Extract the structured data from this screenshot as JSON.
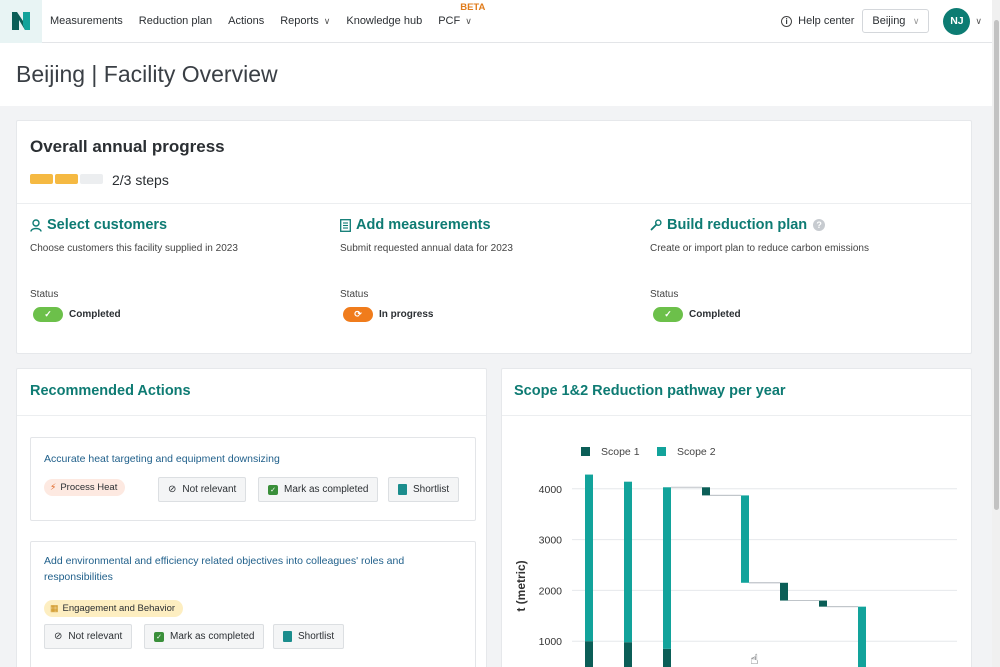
{
  "nav": {
    "items": [
      {
        "label": "Measurements",
        "chevron": false
      },
      {
        "label": "Reduction plan",
        "chevron": false
      },
      {
        "label": "Actions",
        "chevron": false
      },
      {
        "label": "Reports",
        "chevron": true
      },
      {
        "label": "Knowledge hub",
        "chevron": false
      },
      {
        "label": "PCF",
        "chevron": true
      }
    ],
    "beta_label": "BETA",
    "help_label": "Help center",
    "facility_select": "Beijing",
    "avatar_initials": "NJ"
  },
  "page_title": "Beijing | Facility Overview",
  "progress": {
    "title": "Overall annual progress",
    "steps_text": "2/3 steps",
    "completed_steps": 2,
    "total_steps": 3,
    "status_label": "Status",
    "steps": [
      {
        "title": "Select customers",
        "icon": "user-icon",
        "description": "Choose customers this facility supplied in 2023",
        "status": "Completed",
        "status_color": "#6cc04a"
      },
      {
        "title": "Add measurements",
        "icon": "document-list-icon",
        "description": "Submit requested annual data for 2023",
        "status": "In progress",
        "status_color": "#f07c1c"
      },
      {
        "title": "Build reduction plan",
        "icon": "wrench-icon",
        "description": "Create or import plan to reduce carbon emissions",
        "status": "Completed",
        "status_color": "#6cc04a"
      }
    ]
  },
  "recommended": {
    "title": "Recommended Actions",
    "actions": [
      {
        "title": "Accurate heat targeting and equipment downsizing",
        "tag": "Process Heat",
        "tag_color": "#fde9e1"
      },
      {
        "title": "Add environmental and efficiency related objectives into colleagues' roles and responsibilities",
        "tag": "Engagement and Behavior",
        "tag_color": "#fdeec1"
      }
    ],
    "btn_not_relevant": "Not relevant",
    "btn_mark_completed": "Mark as completed",
    "btn_shortlist": "Shortlist"
  },
  "chart_section_title": "Scope 1&2 Reduction pathway per year",
  "chart_data": {
    "type": "bar",
    "title": "Scope 1&2 Reduction pathway per year",
    "ylabel": "t (metric)",
    "xlabel": "",
    "ylim": [
      0,
      4300
    ],
    "yticks": [
      1000,
      2000,
      3000,
      4000
    ],
    "grid": true,
    "legend": "top",
    "series": [
      {
        "name": "Scope 1",
        "color": "#0b5e57"
      },
      {
        "name": "Scope 2",
        "color": "#12a39b"
      }
    ],
    "bars": [
      {
        "kind": "stacked",
        "scope1": 1000,
        "scope2": 3280
      },
      {
        "kind": "stacked",
        "scope1": 980,
        "scope2": 3160
      },
      {
        "kind": "stacked",
        "scope1": 850,
        "scope2": 3180
      },
      {
        "kind": "step",
        "from": 4030,
        "to": 3870,
        "series": "Scope 1"
      },
      {
        "kind": "step",
        "from": 3870,
        "to": 2150,
        "series": "Scope 2"
      },
      {
        "kind": "step",
        "from": 2150,
        "to": 1800,
        "series": "Scope 1"
      },
      {
        "kind": "step",
        "from": 1800,
        "to": 1680,
        "series": "Scope 1"
      },
      {
        "kind": "step",
        "from": 1680,
        "to": 0,
        "series": "Scope 2"
      }
    ]
  },
  "colors": {
    "accent": "#0e7b73",
    "progress_done": "#f5b942",
    "progress_todo": "#eceef0"
  }
}
